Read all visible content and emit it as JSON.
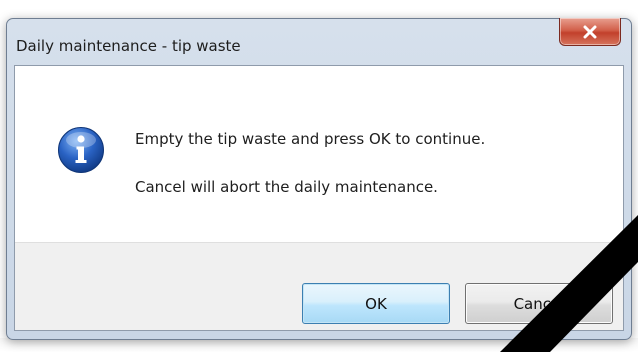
{
  "dialog": {
    "title": "Daily maintenance - tip waste",
    "close_glyph": "x",
    "icon": "information-icon",
    "message_line_1": "Empty the tip waste and press OK to continue.",
    "message_line_2": "Cancel will abort the daily maintenance."
  },
  "buttons": {
    "ok_label": "OK",
    "cancel_label": "Cancel"
  },
  "colors": {
    "close_button": "#c2402b",
    "info_icon": "#2a63c4",
    "ok_border": "#3c7fb1"
  }
}
